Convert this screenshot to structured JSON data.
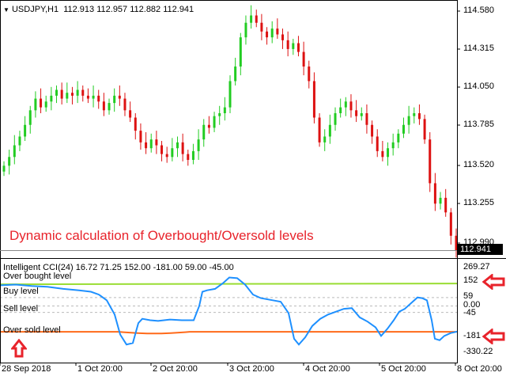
{
  "header": {
    "symbol": "USDJPY,H1",
    "ohlc": "112.913 112.957 112.882 112.941"
  },
  "price_axis": {
    "labels": [
      "114.580",
      "114.315",
      "114.050",
      "113.785",
      "113.520",
      "113.255",
      "112.990"
    ],
    "current_price": "112.941"
  },
  "overlay_text": "Dynamic calculation of Overbought/Oversold levels",
  "indicator": {
    "title": "Intelligent CCI(24) 16.72 71.25 152.00 -181.00 59.00 -45.00",
    "level_labels": {
      "overbought": "Over bought level",
      "buy": "Buy level",
      "sell": "Sell level",
      "oversold": "Over sold level"
    },
    "axis_labels": [
      "269.27",
      "152",
      "59",
      "0.00",
      "-45",
      "-181",
      "-330.22"
    ]
  },
  "time_axis": [
    "28 Sep 2018",
    "1 Oct 20:00",
    "2 Oct 20:00",
    "3 Oct 20:00",
    "4 Oct 20:00",
    "5 Oct 20:00",
    "8 Oct 20:00"
  ],
  "colors": {
    "bull": "#22cc22",
    "bear": "#dd1111",
    "cci": "#1e90ff",
    "overbought_line": "#99dd33",
    "oversold_line": "#ff6a1a",
    "arrow": "#e8232b"
  },
  "chart_data": {
    "type": "candlestick",
    "price_series": [
      113.52,
      113.58,
      113.66,
      113.72,
      113.8,
      113.9,
      113.98,
      113.92,
      113.96,
      114.0,
      114.04,
      113.98,
      114.02,
      114.0,
      114.04,
      114.0,
      113.98,
      114.0,
      113.96,
      113.9,
      113.95,
      114.0,
      113.98,
      113.9,
      113.85,
      113.76,
      113.68,
      113.64,
      113.7,
      113.66,
      113.6,
      113.58,
      113.64,
      113.68,
      113.6,
      113.56,
      113.62,
      113.7,
      113.8,
      113.78,
      113.86,
      113.88,
      113.92,
      114.1,
      114.2,
      114.4,
      114.5,
      114.55,
      114.5,
      114.44,
      114.4,
      114.46,
      114.42,
      114.38,
      114.32,
      114.36,
      114.3,
      114.2,
      114.1,
      113.85,
      113.68,
      113.72,
      113.8,
      113.88,
      113.92,
      113.96,
      113.9,
      113.86,
      113.88,
      113.8,
      113.72,
      113.62,
      113.58,
      113.64,
      113.68,
      113.74,
      113.8,
      113.86,
      113.88,
      113.84,
      113.7,
      113.4,
      113.26,
      113.3,
      113.2,
      113.04,
      112.94
    ],
    "cci_levels": {
      "overbought": 152,
      "buy": 59,
      "zero": 0,
      "sell": -45,
      "oversold": -181
    },
    "cci_range": [
      -330.22,
      269.27
    ]
  }
}
